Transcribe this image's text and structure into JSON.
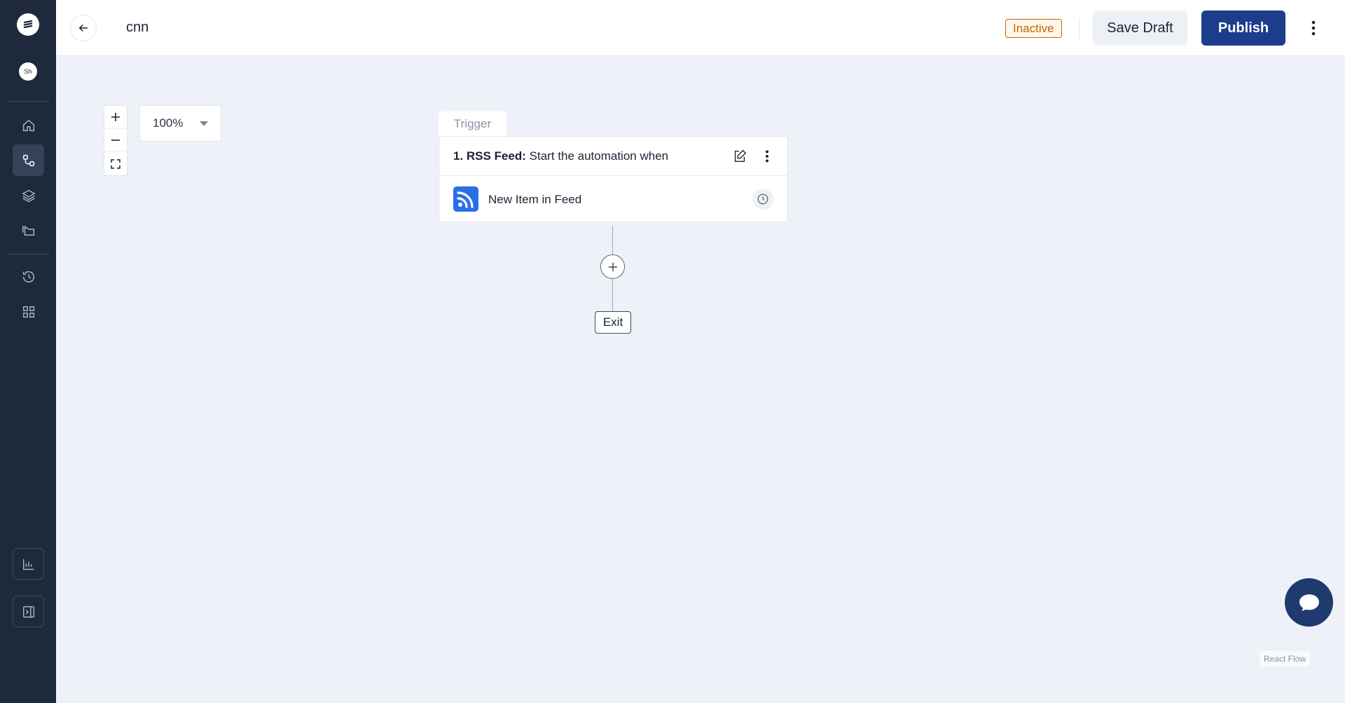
{
  "app": {
    "avatar_initials": "Sh"
  },
  "header": {
    "flow_name": "cnn",
    "status": "Inactive",
    "save_label": "Save Draft",
    "publish_label": "Publish"
  },
  "canvas": {
    "zoom_level": "100%"
  },
  "trigger": {
    "tab_label": "Trigger",
    "step_prefix": "1. RSS Feed:",
    "step_text": " Start the automation when",
    "event_label": "New Item in Feed"
  },
  "exit_label": "Exit",
  "attribution": "React Flow",
  "colors": {
    "sidebar": "#1e2a3b",
    "publish": "#1c3c8c",
    "status": "#c2660a",
    "rss": "#2b6fe8"
  }
}
